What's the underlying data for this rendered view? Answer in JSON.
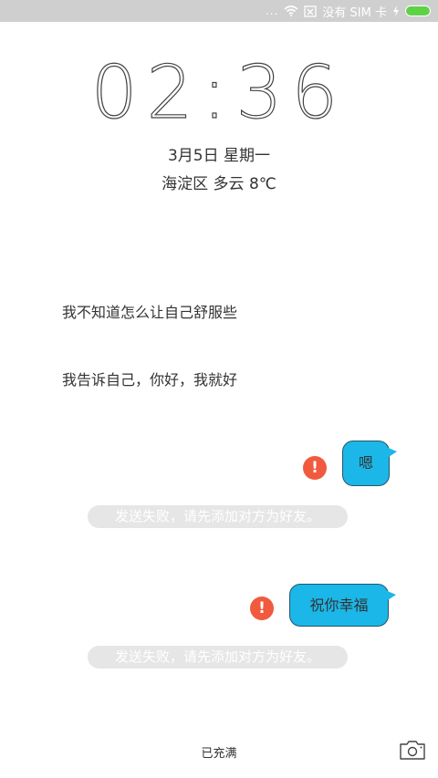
{
  "status_bar": {
    "dots": "...",
    "wifi_icon": "wifi-icon",
    "sim_icon": "no-sim-icon",
    "sim_text": "没有 SIM 卡",
    "charging_icon": "bolt-icon",
    "battery_color": "#5fd146"
  },
  "lock_screen": {
    "clock": "02:36",
    "date": "3月5日 星期一",
    "weather": "海淀区 多云 8℃"
  },
  "messages": {
    "received_1": "我不知道怎么让自己舒服些",
    "received_2": "我告诉自己，你好，我就好",
    "sent_1": "嗯",
    "sent_2": "祝你幸福",
    "fail_mark": "!",
    "fail_notice_1": "发送失败，请先添加对方为好友。",
    "fail_notice_2": "发送失败，请先添加对方为好友。",
    "bubble_color": "#1bb7e8",
    "fail_color": "#f15a3e"
  },
  "bottom": {
    "charge_status": "已充满",
    "camera_icon": "camera-icon"
  }
}
